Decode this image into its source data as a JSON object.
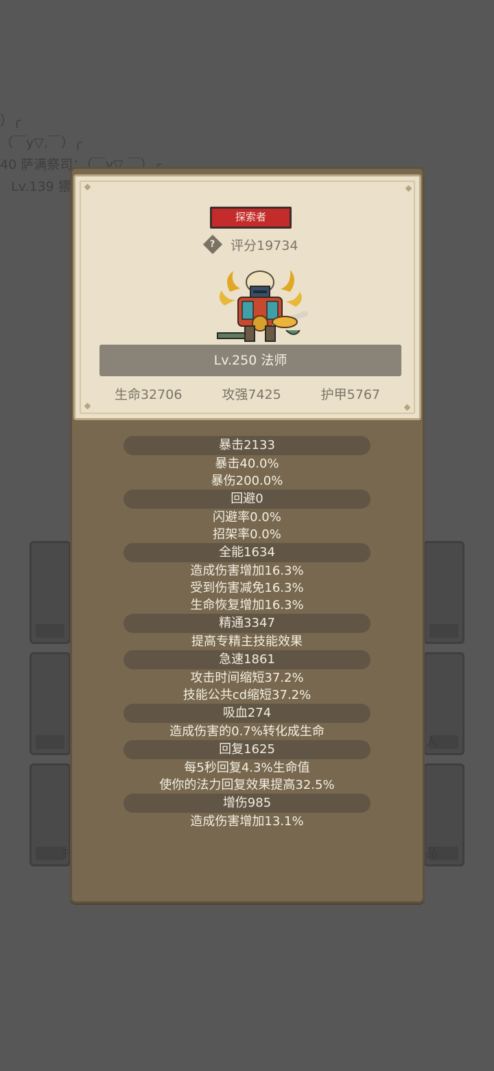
{
  "background": {
    "chat_lines": [
      "）╭",
      "（￣y▽,￣）╭",
      "40 萨满祭司：（￣y▽,￣）╭",
      "Lv.139 猥"
    ],
    "tile_labels": [
      "扌",
      "人",
      "品"
    ]
  },
  "hero": {
    "title": "探索者",
    "score_label": "评分19734",
    "help_icon": "?",
    "level_class": "Lv.250 法师",
    "stats": [
      "生命32706",
      "攻强7425",
      "护甲5767"
    ]
  },
  "attributes": [
    {
      "header": "暴击2133",
      "lines": [
        "暴击40.0%",
        "暴伤200.0%"
      ]
    },
    {
      "header": "回避0",
      "lines": [
        "闪避率0.0%",
        "招架率0.0%"
      ]
    },
    {
      "header": "全能1634",
      "lines": [
        "造成伤害增加16.3%",
        "受到伤害减免16.3%",
        "生命恢复增加16.3%"
      ]
    },
    {
      "header": "精通3347",
      "lines": [
        "提高专精主技能效果"
      ]
    },
    {
      "header": "急速1861",
      "lines": [
        "攻击时间缩短37.2%",
        "技能公共cd缩短37.2%"
      ]
    },
    {
      "header": "吸血274",
      "lines": [
        "造成伤害的0.7%转化成生命"
      ]
    },
    {
      "header": "回复1625",
      "lines": [
        "每5秒回复4.3%生命值",
        "使你的法力回复效果提高32.5%"
      ]
    },
    {
      "header": "增伤985",
      "lines": [
        "造成伤害增加13.1%"
      ]
    }
  ],
  "colors": {
    "overlay": "#575757",
    "panel": "#77684f",
    "parchment": "#ebe0c9",
    "title_badge": "#c42b2b",
    "attr_header": "#615646"
  }
}
